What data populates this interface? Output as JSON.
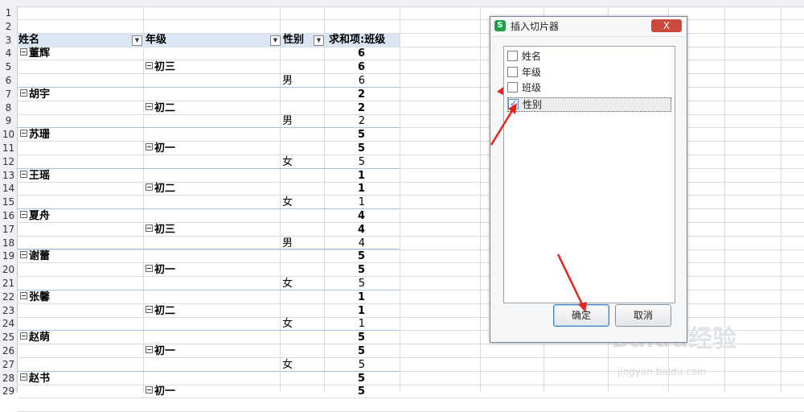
{
  "row_numbers": [
    "1",
    "2",
    "3",
    "4",
    "5",
    "6",
    "7",
    "8",
    "9",
    "10",
    "11",
    "12",
    "13",
    "14",
    "15",
    "16",
    "17",
    "18",
    "19",
    "20",
    "21",
    "22",
    "23",
    "24",
    "25",
    "26",
    "27",
    "28",
    "29"
  ],
  "pivot": {
    "headers": {
      "name": "姓名",
      "grade": "年级",
      "gender": "性别",
      "sum": "求和项:班级"
    },
    "groups": [
      {
        "name": "董辉",
        "total": "6",
        "grade": "初三",
        "grade_total": "6",
        "gender": "男",
        "value": "6"
      },
      {
        "name": "胡宇",
        "total": "2",
        "grade": "初二",
        "grade_total": "2",
        "gender": "男",
        "value": "2"
      },
      {
        "name": "苏珊",
        "total": "5",
        "grade": "初一",
        "grade_total": "5",
        "gender": "女",
        "value": "5"
      },
      {
        "name": "王瑶",
        "total": "1",
        "grade": "初二",
        "grade_total": "1",
        "gender": "女",
        "value": "1"
      },
      {
        "name": "夏舟",
        "total": "4",
        "grade": "初三",
        "grade_total": "4",
        "gender": "男",
        "value": "4"
      },
      {
        "name": "谢蕾",
        "total": "5",
        "grade": "初一",
        "grade_total": "5",
        "gender": "女",
        "value": "5"
      },
      {
        "name": "张馨",
        "total": "1",
        "grade": "初二",
        "grade_total": "1",
        "gender": "女",
        "value": "1"
      },
      {
        "name": "赵萌",
        "total": "5",
        "grade": "初一",
        "grade_total": "5",
        "gender": "女",
        "value": "5"
      },
      {
        "name": "赵书",
        "total": "5",
        "grade": "初一",
        "grade_total": "5"
      }
    ]
  },
  "dialog": {
    "title": "插入切片器",
    "app_icon_letter": "S",
    "close_label": "X",
    "fields": [
      {
        "label": "姓名",
        "checked": false
      },
      {
        "label": "年级",
        "checked": false
      },
      {
        "label": "班级",
        "checked": false
      },
      {
        "label": "性别",
        "checked": true
      }
    ],
    "ok_label": "确定",
    "cancel_label": "取消"
  },
  "watermark": {
    "text": "Baidu经验",
    "url": "jingyan.baidu.com"
  },
  "colors": {
    "accent_red": "#e8221b",
    "pivot_header": "#dae6f3",
    "close_red": "#c94a3c"
  }
}
